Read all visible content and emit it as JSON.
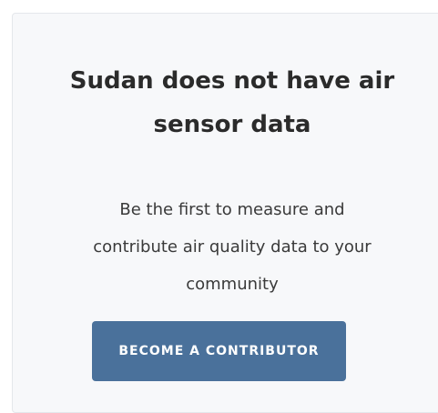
{
  "empty_state": {
    "title_line1": "Sudan does not have air",
    "title_line2": "sensor data",
    "message_line1": "Be the first to measure and",
    "message_line2": "contribute air quality data to your",
    "message_line3": "community",
    "cta_label": "BECOME A CONTRIBUTOR"
  },
  "colors": {
    "card_background": "#f7f8fa",
    "button_background": "#4a719b",
    "button_text": "#ffffff",
    "heading_text": "#2b2b2b"
  }
}
